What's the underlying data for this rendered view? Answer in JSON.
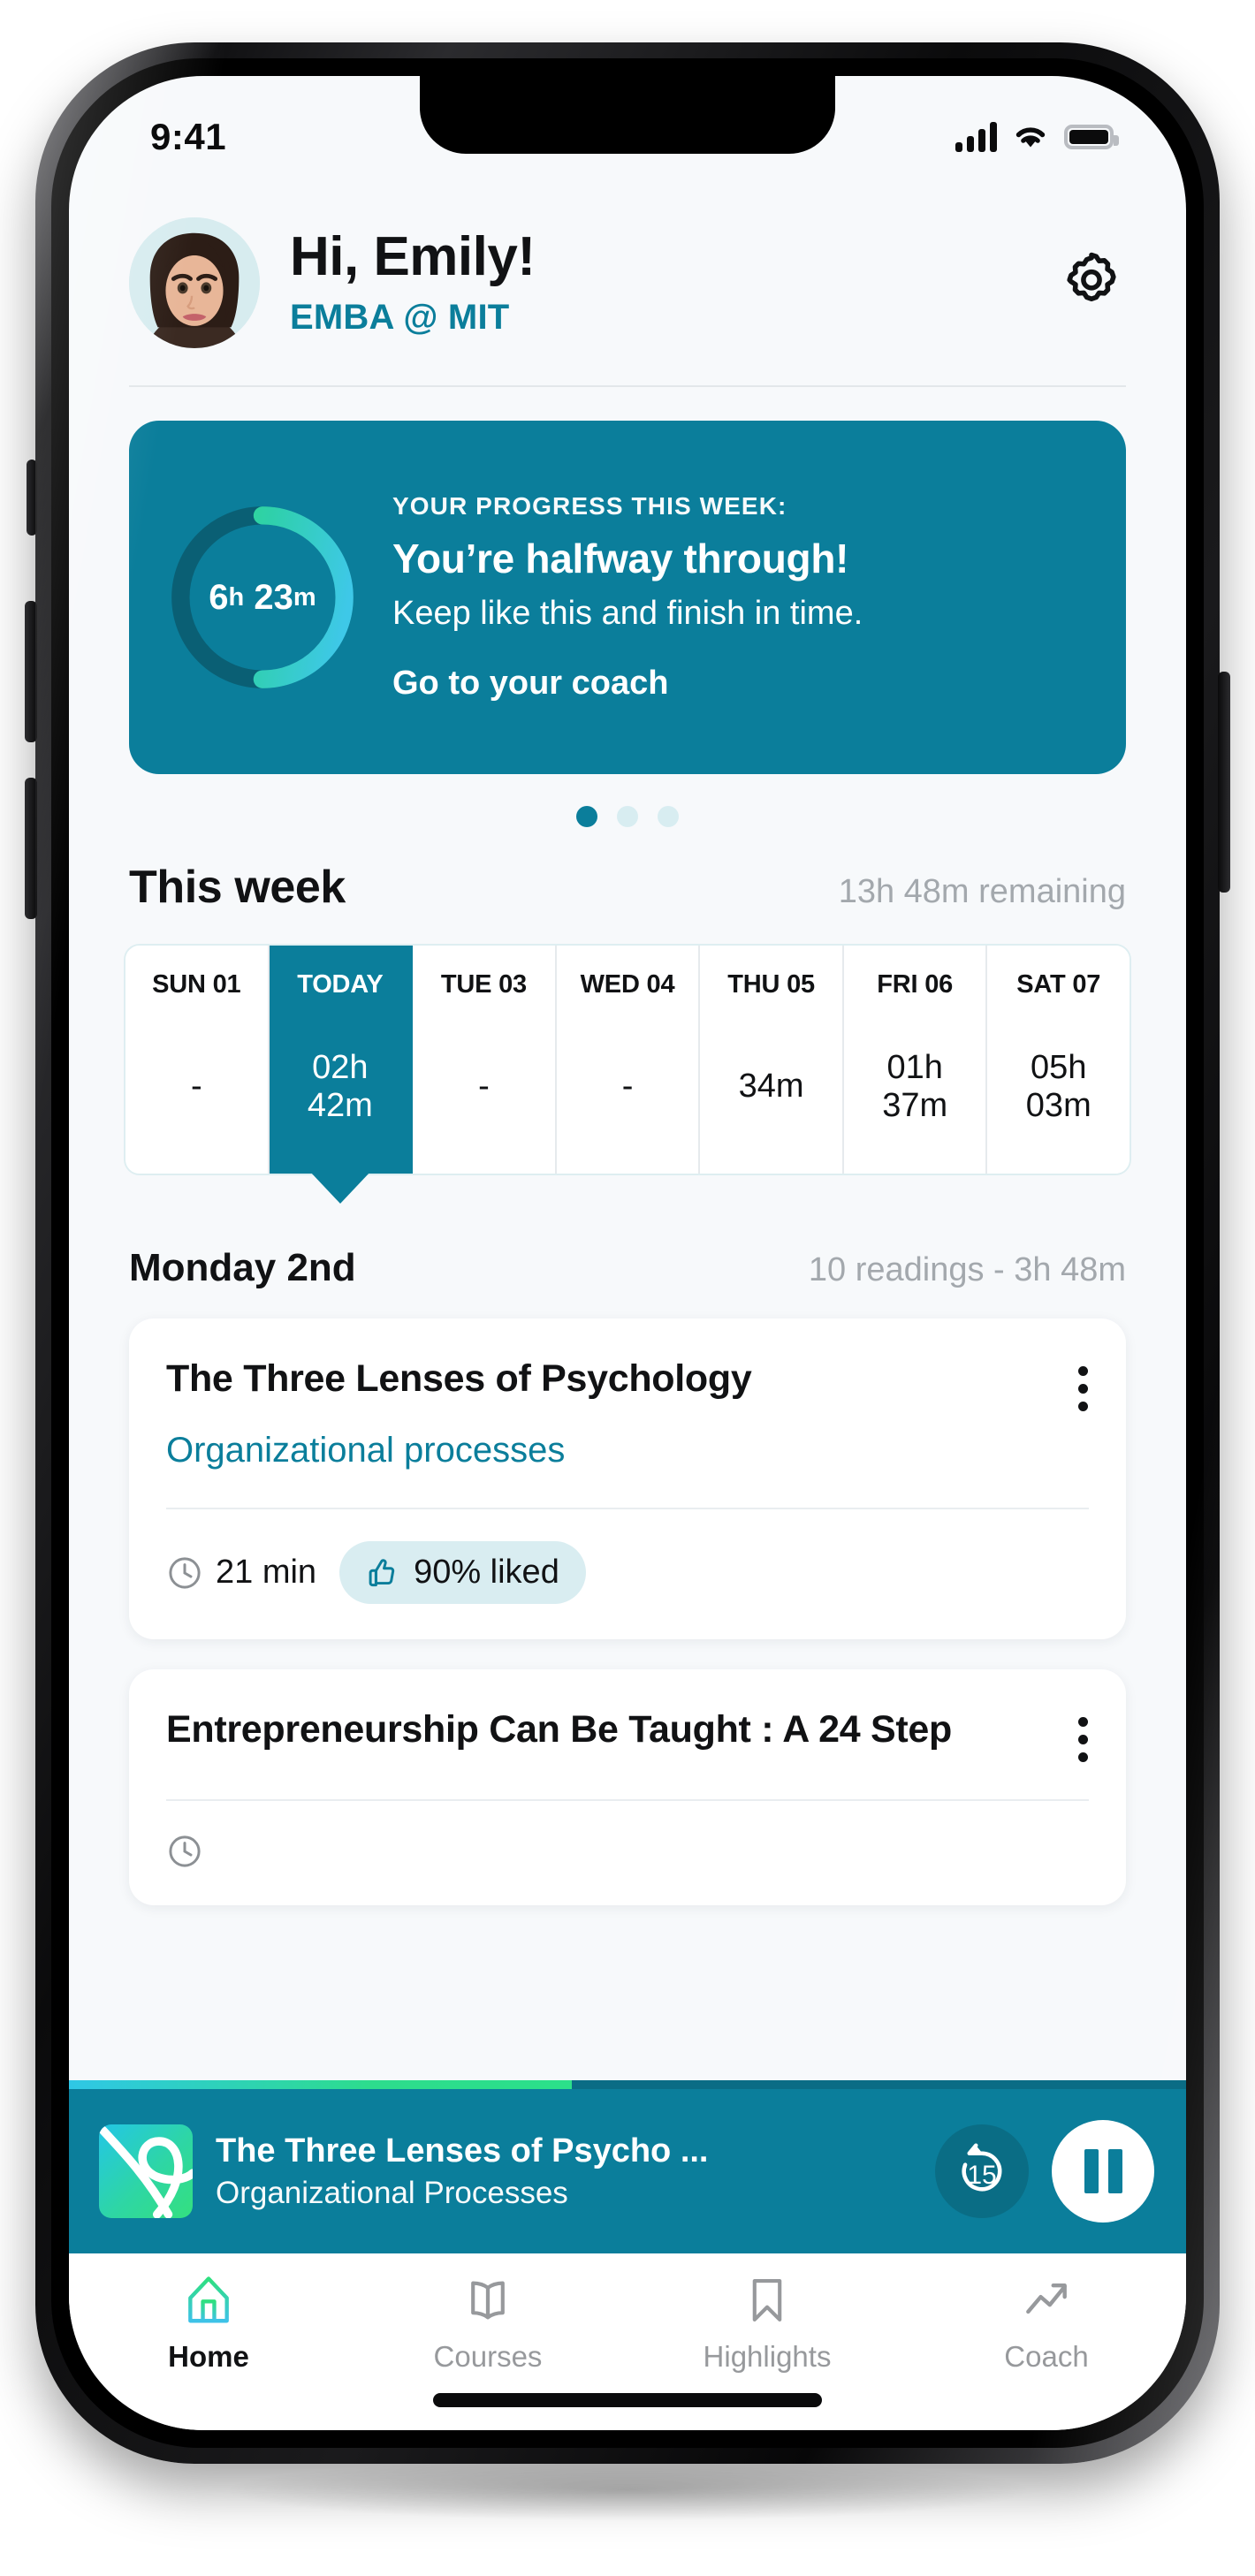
{
  "status_bar": {
    "time": "9:41",
    "signal_icon": "cellular-signal-icon",
    "wifi_icon": "wifi-icon",
    "battery_icon": "battery-icon"
  },
  "header": {
    "avatar_alt": "user-avatar",
    "greeting": "Hi, Emily!",
    "subtitle": "EMBA @ MIT",
    "settings_icon": "gear-icon"
  },
  "progress_card": {
    "kicker": "YOUR PROGRESS THIS WEEK:",
    "title": "You’re halfway through!",
    "subtitle": "Keep like this and finish in time.",
    "link": "Go to your coach",
    "ring_hours": "6",
    "ring_hours_unit": "h",
    "ring_minutes": "23",
    "ring_minutes_unit": "m",
    "ring_percent": 50,
    "ring_track_color": "#0a5f74",
    "ring_gradient_start": "#2ee07f",
    "ring_gradient_end": "#3ec8e8",
    "card_color": "#0b7e9b"
  },
  "carousel": {
    "dots": 3,
    "active_index": 0,
    "active_color": "#0b7e9b",
    "inactive_color": "#d8edf1"
  },
  "week_section": {
    "title": "This week",
    "meta": "13h 48m remaining",
    "days": [
      {
        "name": "SUN 01",
        "value": "-",
        "today": false
      },
      {
        "name": "TODAY",
        "value": "02h\n42m",
        "today": true
      },
      {
        "name": "TUE 03",
        "value": "-",
        "today": false
      },
      {
        "name": "WED 04",
        "value": "-",
        "today": false
      },
      {
        "name": "THU 05",
        "value": "34m",
        "today": false
      },
      {
        "name": "FRI 06",
        "value": "01h\n37m",
        "today": false
      },
      {
        "name": "SAT 07",
        "value": "05h\n03m",
        "today": false
      }
    ]
  },
  "day_section": {
    "title": "Monday 2nd",
    "meta": "10 readings - 3h 48m"
  },
  "readings": [
    {
      "title": "The Three Lenses of Psychology",
      "category": "Organizational processes",
      "duration": "21 min",
      "liked": "90% liked",
      "clock_icon": "clock-icon",
      "like_icon": "thumbs-up-icon",
      "menu_icon": "kebab-menu-icon"
    },
    {
      "title": "Entrepreneurship Can Be Taught : A 24 Step",
      "category": "",
      "duration": "",
      "liked": "",
      "clock_icon": "clock-icon",
      "like_icon": "thumbs-up-icon",
      "menu_icon": "kebab-menu-icon"
    }
  ],
  "player": {
    "title": "The Three Lenses of Psycho ...",
    "subtitle": "Organizational Processes",
    "rewind_seconds": "15",
    "rewind_icon": "rewind-15-icon",
    "playpause_icon": "pause-icon",
    "artwork_icon": "app-logo-artwork",
    "progress_percent": 45,
    "bar_color": "#0b7e9b"
  },
  "tabbar": {
    "items": [
      {
        "label": "Home",
        "icon": "home-icon",
        "active": true
      },
      {
        "label": "Courses",
        "icon": "book-icon",
        "active": false
      },
      {
        "label": "Highlights",
        "icon": "bookmark-icon",
        "active": false
      },
      {
        "label": "Coach",
        "icon": "trending-up-icon",
        "active": false
      }
    ]
  }
}
